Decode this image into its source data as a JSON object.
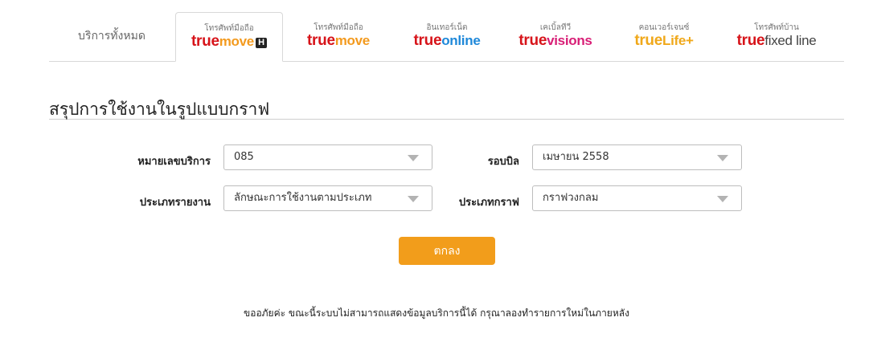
{
  "tabs": {
    "all_label": "บริการทั้งหมด",
    "items": [
      {
        "sub": "โทรศัพท์มือถือ",
        "brand_t": "true",
        "brand_p": "move",
        "badge": "H"
      },
      {
        "sub": "โทรศัพท์มือถือ",
        "brand_t": "true",
        "brand_p": "move"
      },
      {
        "sub": "อินเทอร์เน็ต",
        "brand_t": "true",
        "brand_p": "online"
      },
      {
        "sub": "เคเบิ้ลทีวี",
        "brand_t": "true",
        "brand_p": "visions"
      },
      {
        "sub": "คอนเวอร์เจนซ์",
        "brand_t": "true",
        "brand_p": "Life+"
      },
      {
        "sub": "โทรศัพท์บ้าน",
        "brand_t": "true",
        "brand_p": "fixed line"
      }
    ]
  },
  "section_title": "สรุปการใช้งานในรูปแบบกราฟ",
  "form": {
    "service_number_label": "หมายเลขบริการ",
    "service_number_value": "085",
    "bill_cycle_label": "รอบบิล",
    "bill_cycle_value": "เมษายน 2558",
    "report_type_label": "ประเภทรายงาน",
    "report_type_value": "ลักษณะการใช้งานตามประเภท",
    "graph_type_label": "ประเภทกราฟ",
    "graph_type_value": "กราฟวงกลม",
    "submit_label": "ตกลง"
  },
  "notice": "ขออภัยค่ะ ขณะนี้ระบบไม่สามารถแสดงข้อมูลบริการนี้ได้ กรุณาลองทำรายการใหม่ในภายหลัง",
  "colors": {
    "true_red": "#d7141a",
    "move_orange": "#f39a1e",
    "online_blue": "#1e88d9",
    "visions_pink": "#d81e76",
    "button_orange": "#f29d1b"
  }
}
